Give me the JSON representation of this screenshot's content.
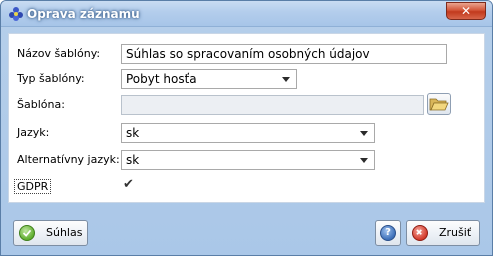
{
  "window": {
    "title": "Oprava záznamu",
    "close_glyph": "✕"
  },
  "form": {
    "template_name": {
      "label": "Názov šablóny:",
      "value": "Súhlas so spracovaním osobných údajov"
    },
    "template_type": {
      "label": "Typ šablóny:",
      "value": "Pobyt hosťa"
    },
    "template_file": {
      "label": "Šablóna:",
      "value": ""
    },
    "language": {
      "label": "Jazyk:",
      "value": "sk"
    },
    "alt_language": {
      "label": "Alternatívny jazyk:",
      "value": "sk"
    },
    "gdpr": {
      "label": "GDPR",
      "checked": true,
      "check_glyph": "✔"
    }
  },
  "buttons": {
    "agree": {
      "label": "Súhlas",
      "icon": "check-circle-icon"
    },
    "help": {
      "label": "?",
      "icon": "help-icon"
    },
    "cancel": {
      "label": "Zrušiť",
      "icon": "cancel-icon"
    }
  },
  "colors": {
    "accent": "#a7c5e8",
    "close_red": "#c23a1e",
    "ok_green": "#5fae2f",
    "cancel_red": "#d33a2b",
    "help_blue": "#3c6fb9"
  }
}
